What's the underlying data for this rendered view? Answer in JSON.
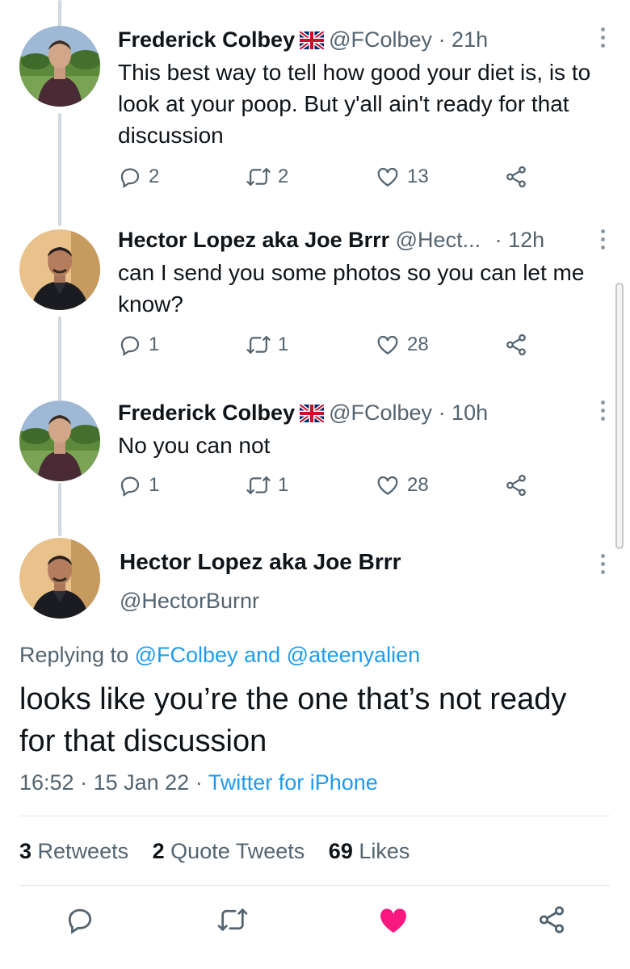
{
  "tweets": [
    {
      "name": "Frederick Colbey",
      "flag": "uk-flag",
      "handle": "@FColbey",
      "time": "· 21h",
      "text": "This best way to tell how good your diet is, is to look at your poop. But y'all ain't ready for that discussion",
      "replies": "2",
      "retweets": "2",
      "likes": "13"
    },
    {
      "name": "Hector Lopez aka Joe Brrr",
      "handle": "@Hect...",
      "time": "· 12h",
      "text": "can I send you some photos so you can let me know?",
      "replies": "1",
      "retweets": "1",
      "likes": "28"
    },
    {
      "name": "Frederick Colbey",
      "flag": "uk-flag",
      "handle": "@FColbey",
      "time": "· 10h",
      "text": "No you can not",
      "replies": "1",
      "retweets": "1",
      "likes": "28"
    }
  ],
  "main_tweet": {
    "name": "Hector Lopez aka Joe Brrr",
    "handle": "@HectorBurnr",
    "replying_prefix": "Replying to",
    "replying_user1": "@FColbey",
    "replying_and": "and",
    "replying_user2": "@ateenyalien",
    "text": "looks like you’re the one that’s not ready for that discussion",
    "time": "16:52",
    "date": "15 Jan 22",
    "source": "Twitter for iPhone",
    "retweets_count": "3",
    "retweets_label": "Retweets",
    "quotes_count": "2",
    "quotes_label": "Quote Tweets",
    "likes_count": "69",
    "likes_label": "Likes",
    "liked": true
  },
  "colors": {
    "link": "#1d9bf0",
    "liked_heart": "#f91880",
    "secondary_text": "#536471",
    "thread_line": "#cfd9de"
  }
}
